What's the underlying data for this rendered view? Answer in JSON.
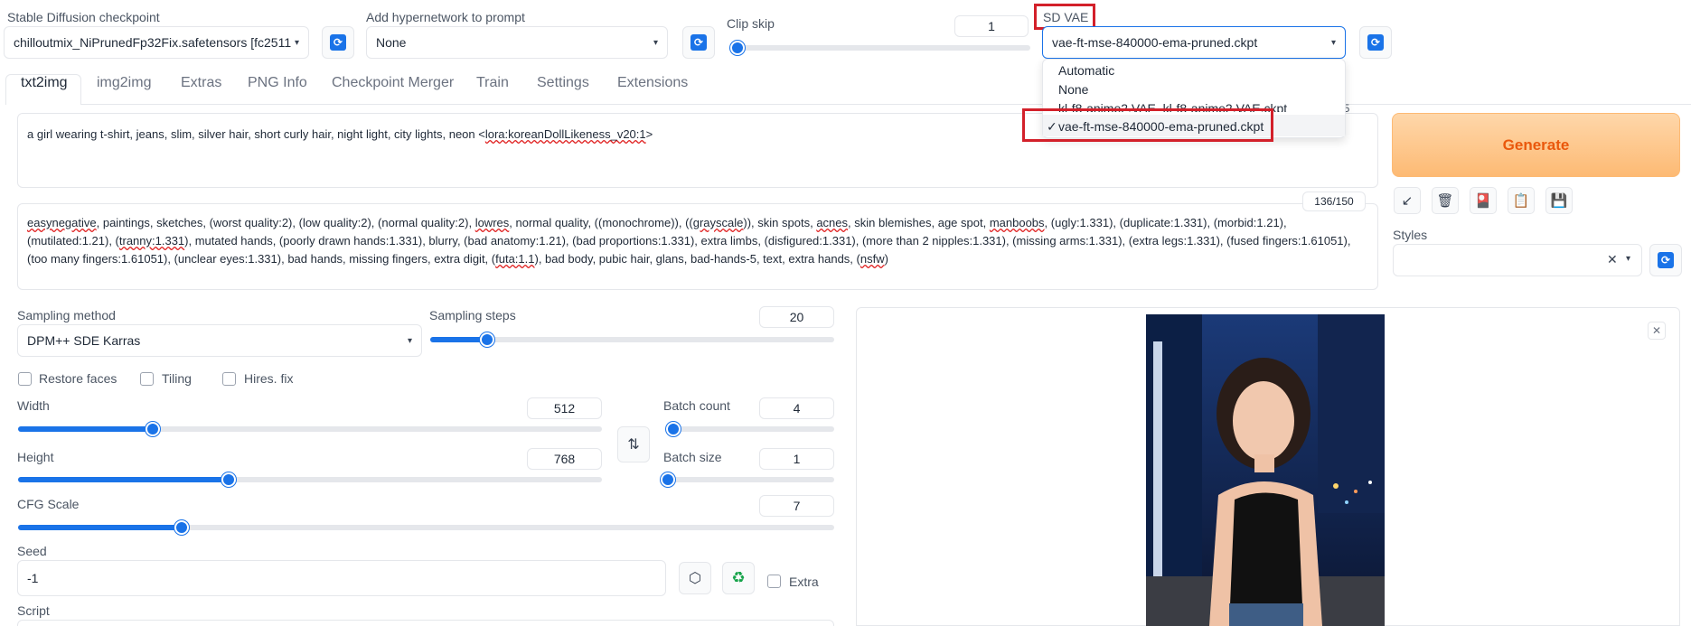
{
  "header": {
    "checkpoint": {
      "label": "Stable Diffusion checkpoint",
      "value": "chilloutmix_NiPrunedFp32Fix.safetensors [fc2511"
    },
    "hypernetwork": {
      "label": "Add hypernetwork to prompt",
      "value": "None"
    },
    "clip_skip": {
      "label": "Clip skip",
      "value": "1",
      "fraction": 0.0
    },
    "sd_vae": {
      "label": "SD VAE",
      "value": "vae-ft-mse-840000-ema-pruned.ckpt",
      "options": [
        "Automatic",
        "None",
        "kl-f8-anime2.VAE_kl-f8-anime2.VAE.ckpt",
        "vae-ft-mse-840000-ema-pruned.ckpt"
      ],
      "check_mark": "✓"
    }
  },
  "tabs": [
    "txt2img",
    "img2img",
    "Extras",
    "PNG Info",
    "Checkpoint Merger",
    "Train",
    "Settings",
    "Extensions"
  ],
  "active_tab": "txt2img",
  "prompt": {
    "positive_prefix": "a girl wearing t-shirt, jeans, slim, silver hair, short curly hair, night light, city lights, neon <",
    "positive_lora": "lora:koreanDollLikeness_v20:1",
    "positive_suffix": ">",
    "token_count_hidden": "75",
    "negative_token_count": "136/150",
    "negative_line1_parts": [
      "easynegative",
      ", paintings, sketches, (worst quality:2), (low quality:2), (normal quality:2), ",
      "lowres",
      ", normal quality, ((monochrome)), ((",
      "grayscale",
      ")), skin spots, ",
      "acnes",
      ", skin blemishes, age spot, ",
      "manboobs",
      ", (ugly:1.331), (duplicate:1.331), (morbid:1.21),"
    ],
    "negative_line2_parts": [
      "(mutilated:1.21), (",
      "tranny:1.331",
      "), mutated hands, (poorly drawn hands:1.331), blurry, (bad anatomy:1.21), (bad proportions:1.331), extra limbs, (disfigured:1.331), (more than 2 nipples:1.331), (missing arms:1.331), (extra legs:1.331), (fused fingers:1.61051),"
    ],
    "negative_line3_parts": [
      "(too many fingers:1.61051), (unclear eyes:1.331), bad hands, missing fingers, extra digit, (",
      "futa:1.1",
      "), bad body, pubic hair, glans, bad-hands-5, text, extra hands, (",
      "nsfw",
      ")"
    ]
  },
  "generate_label": "Generate",
  "styles_label": "Styles",
  "settings": {
    "sampling_method": {
      "label": "Sampling method",
      "value": "DPM++ SDE Karras"
    },
    "sampling_steps": {
      "label": "Sampling steps",
      "value": "20",
      "fraction": 0.14
    },
    "restore_faces": "Restore faces",
    "tiling": "Tiling",
    "hires_fix": "Hires. fix",
    "width": {
      "label": "Width",
      "value": "512",
      "fraction": 0.23
    },
    "height": {
      "label": "Height",
      "value": "768",
      "fraction": 0.36
    },
    "batch_count": {
      "label": "Batch count",
      "value": "4",
      "fraction": 0.03
    },
    "batch_size": {
      "label": "Batch size",
      "value": "1",
      "fraction": 0.0
    },
    "cfg_scale": {
      "label": "CFG Scale",
      "value": "7",
      "fraction": 0.2
    },
    "seed": {
      "label": "Seed",
      "value": "-1"
    },
    "extra": "Extra",
    "script": "Script"
  },
  "colors": {
    "accent": "#1a73e8",
    "highlight": "#d3202a",
    "generate_from": "#fdba74",
    "generate_to": "#fed7aa",
    "generate_text": "#ea580c"
  },
  "icons": [
    "refresh-icon",
    "swap-icon",
    "dice-icon",
    "recycle-icon",
    "paste-icon",
    "trash-icon",
    "style-icon",
    "clipboard-icon",
    "save-icon",
    "close-icon"
  ]
}
